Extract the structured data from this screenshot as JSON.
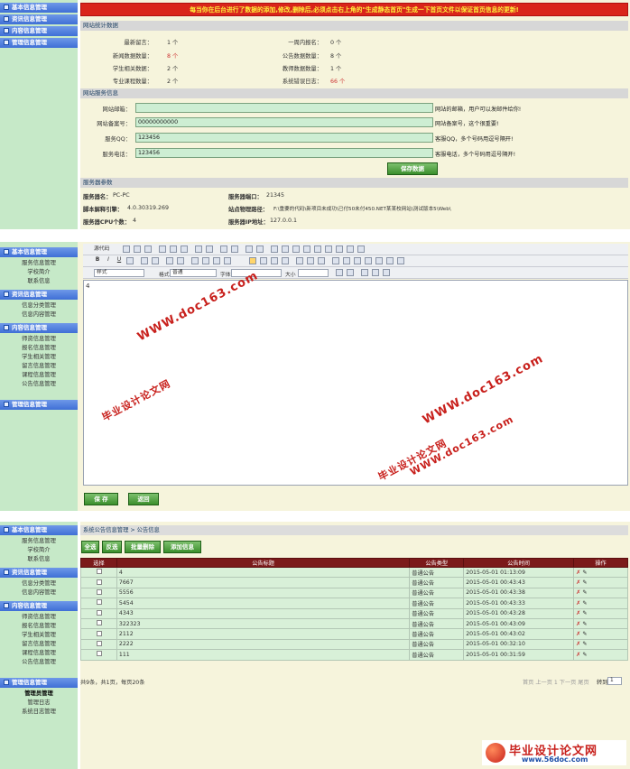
{
  "sidebar_sections": {
    "basic": "基本信息管理",
    "resource": "资讯信息管理",
    "content": "内容信息管理",
    "admin": "管理信息管理"
  },
  "sidebar_items": {
    "basic": [
      "服务信息管理",
      "学校简介",
      "联系信息"
    ],
    "resource": [
      "信息分类管理",
      "信息内容管理"
    ],
    "content": [
      "师资信息管理",
      "报名信息管理",
      "学生相关管理",
      "留言信息管理",
      "课程信息管理",
      "公告信息管理"
    ],
    "admin": [
      "管理员管理",
      "管理日志",
      "系统日志管理"
    ]
  },
  "dashboard": {
    "banner": "每当你在后台进行了数据的添加,修改,删除后,必须点击右上角的\"生成静态首页\"生成一下首页文件以保证首页信息的更新!",
    "stats_title": "网站统计数据",
    "stats": [
      {
        "label": "最新留言：",
        "value": "1 个",
        "label2": "一周内报名：",
        "value2": "0 个"
      },
      {
        "label": "新闻数据数量：",
        "value": "8 个",
        "label2": "公告数据数量：",
        "value2": "8 个"
      },
      {
        "label": "学生相关数据：",
        "value": "2 个",
        "label2": "教师数据数量：",
        "value2": "1 个"
      },
      {
        "label": "专业课程数量：",
        "value": "2 个",
        "label2": "系统错误日志：",
        "value2": "66 个"
      }
    ],
    "service_title": "网站服务信息",
    "service_fields": [
      {
        "label": "网站邮箱：",
        "value": "",
        "note": "网站的邮箱，用户可以发邮件给你!"
      },
      {
        "label": "网站备案号：",
        "value": "00000000000",
        "note": "网站备案号，这个很重要!"
      },
      {
        "label": "服务QQ：",
        "value": "123456",
        "note": "客服QQ，多个号码用逗号隔开!"
      },
      {
        "label": "服务电话：",
        "value": "123456",
        "note": "客服电话，多个号码用逗号隔开!"
      }
    ],
    "save_data_label": "保存数据",
    "server_title": "服务器参数",
    "server": [
      {
        "label": "服务器名：",
        "value": "PC-PC",
        "label2": "服务器端口：",
        "value2": "21345"
      },
      {
        "label": "脚本解释引擎：",
        "value": "4.0.30319.269",
        "label2": "站点物理路径：",
        "value2": "F:\\重要的代码\\新项目未成功\\已付50未付450.NET某某校网站\\测试版本5\\Web\\"
      },
      {
        "label": "服务器CPU个数：",
        "value": "4",
        "label2": "服务器IP地址：",
        "value2": "127.0.0.1"
      }
    ]
  },
  "editor": {
    "source_label": "源代码",
    "style_label": "样式",
    "format_label": "格式",
    "format_value": "普通",
    "font_label": "字体",
    "size_label": "大小",
    "content": "4",
    "save_label": "保 存",
    "back_label": "返回",
    "watermarks": [
      "WWW.doc163.com",
      "毕业设计论文网"
    ]
  },
  "list": {
    "breadcrumb": "系统公告信息管理 > 公告信息",
    "buttons": [
      "全选",
      "反选",
      "批量删除",
      "添加信息"
    ],
    "columns": [
      "选择",
      "公告标题",
      "公告类型",
      "公告时间",
      "操作"
    ],
    "rows": [
      {
        "title": "4",
        "type": "普通公告",
        "time": "2015-05-01 01:13:09"
      },
      {
        "title": "7667",
        "type": "普通公告",
        "time": "2015-05-01 00:43:43"
      },
      {
        "title": "5556",
        "type": "普通公告",
        "time": "2015-05-01 00:43:38"
      },
      {
        "title": "5454",
        "type": "普通公告",
        "time": "2015-05-01 00:43:33"
      },
      {
        "title": "4343",
        "type": "普通公告",
        "time": "2015-05-01 00:43:28"
      },
      {
        "title": "322323",
        "type": "普通公告",
        "time": "2015-05-01 00:43:09"
      },
      {
        "title": "2112",
        "type": "普通公告",
        "time": "2015-05-01 00:43:02"
      },
      {
        "title": "2222",
        "type": "普通公告",
        "time": "2015-05-01 00:32:10"
      },
      {
        "title": "111",
        "type": "普通公告",
        "time": "2015-05-01 00:31:59"
      }
    ],
    "pager_info": "共9条，共1页，每页20条",
    "pager_nav": "首页 上一页 1 下一页 尾页",
    "jump_label": "转到",
    "page_value": "1"
  },
  "logo": {
    "title": "毕业设计论文网",
    "url": "www.56doc.com"
  },
  "colors": {
    "sidebar": "#c6e9c8",
    "banner": "#d9251b",
    "header_row": "#7b1a1a",
    "accent_green": "#3b8f2c"
  }
}
